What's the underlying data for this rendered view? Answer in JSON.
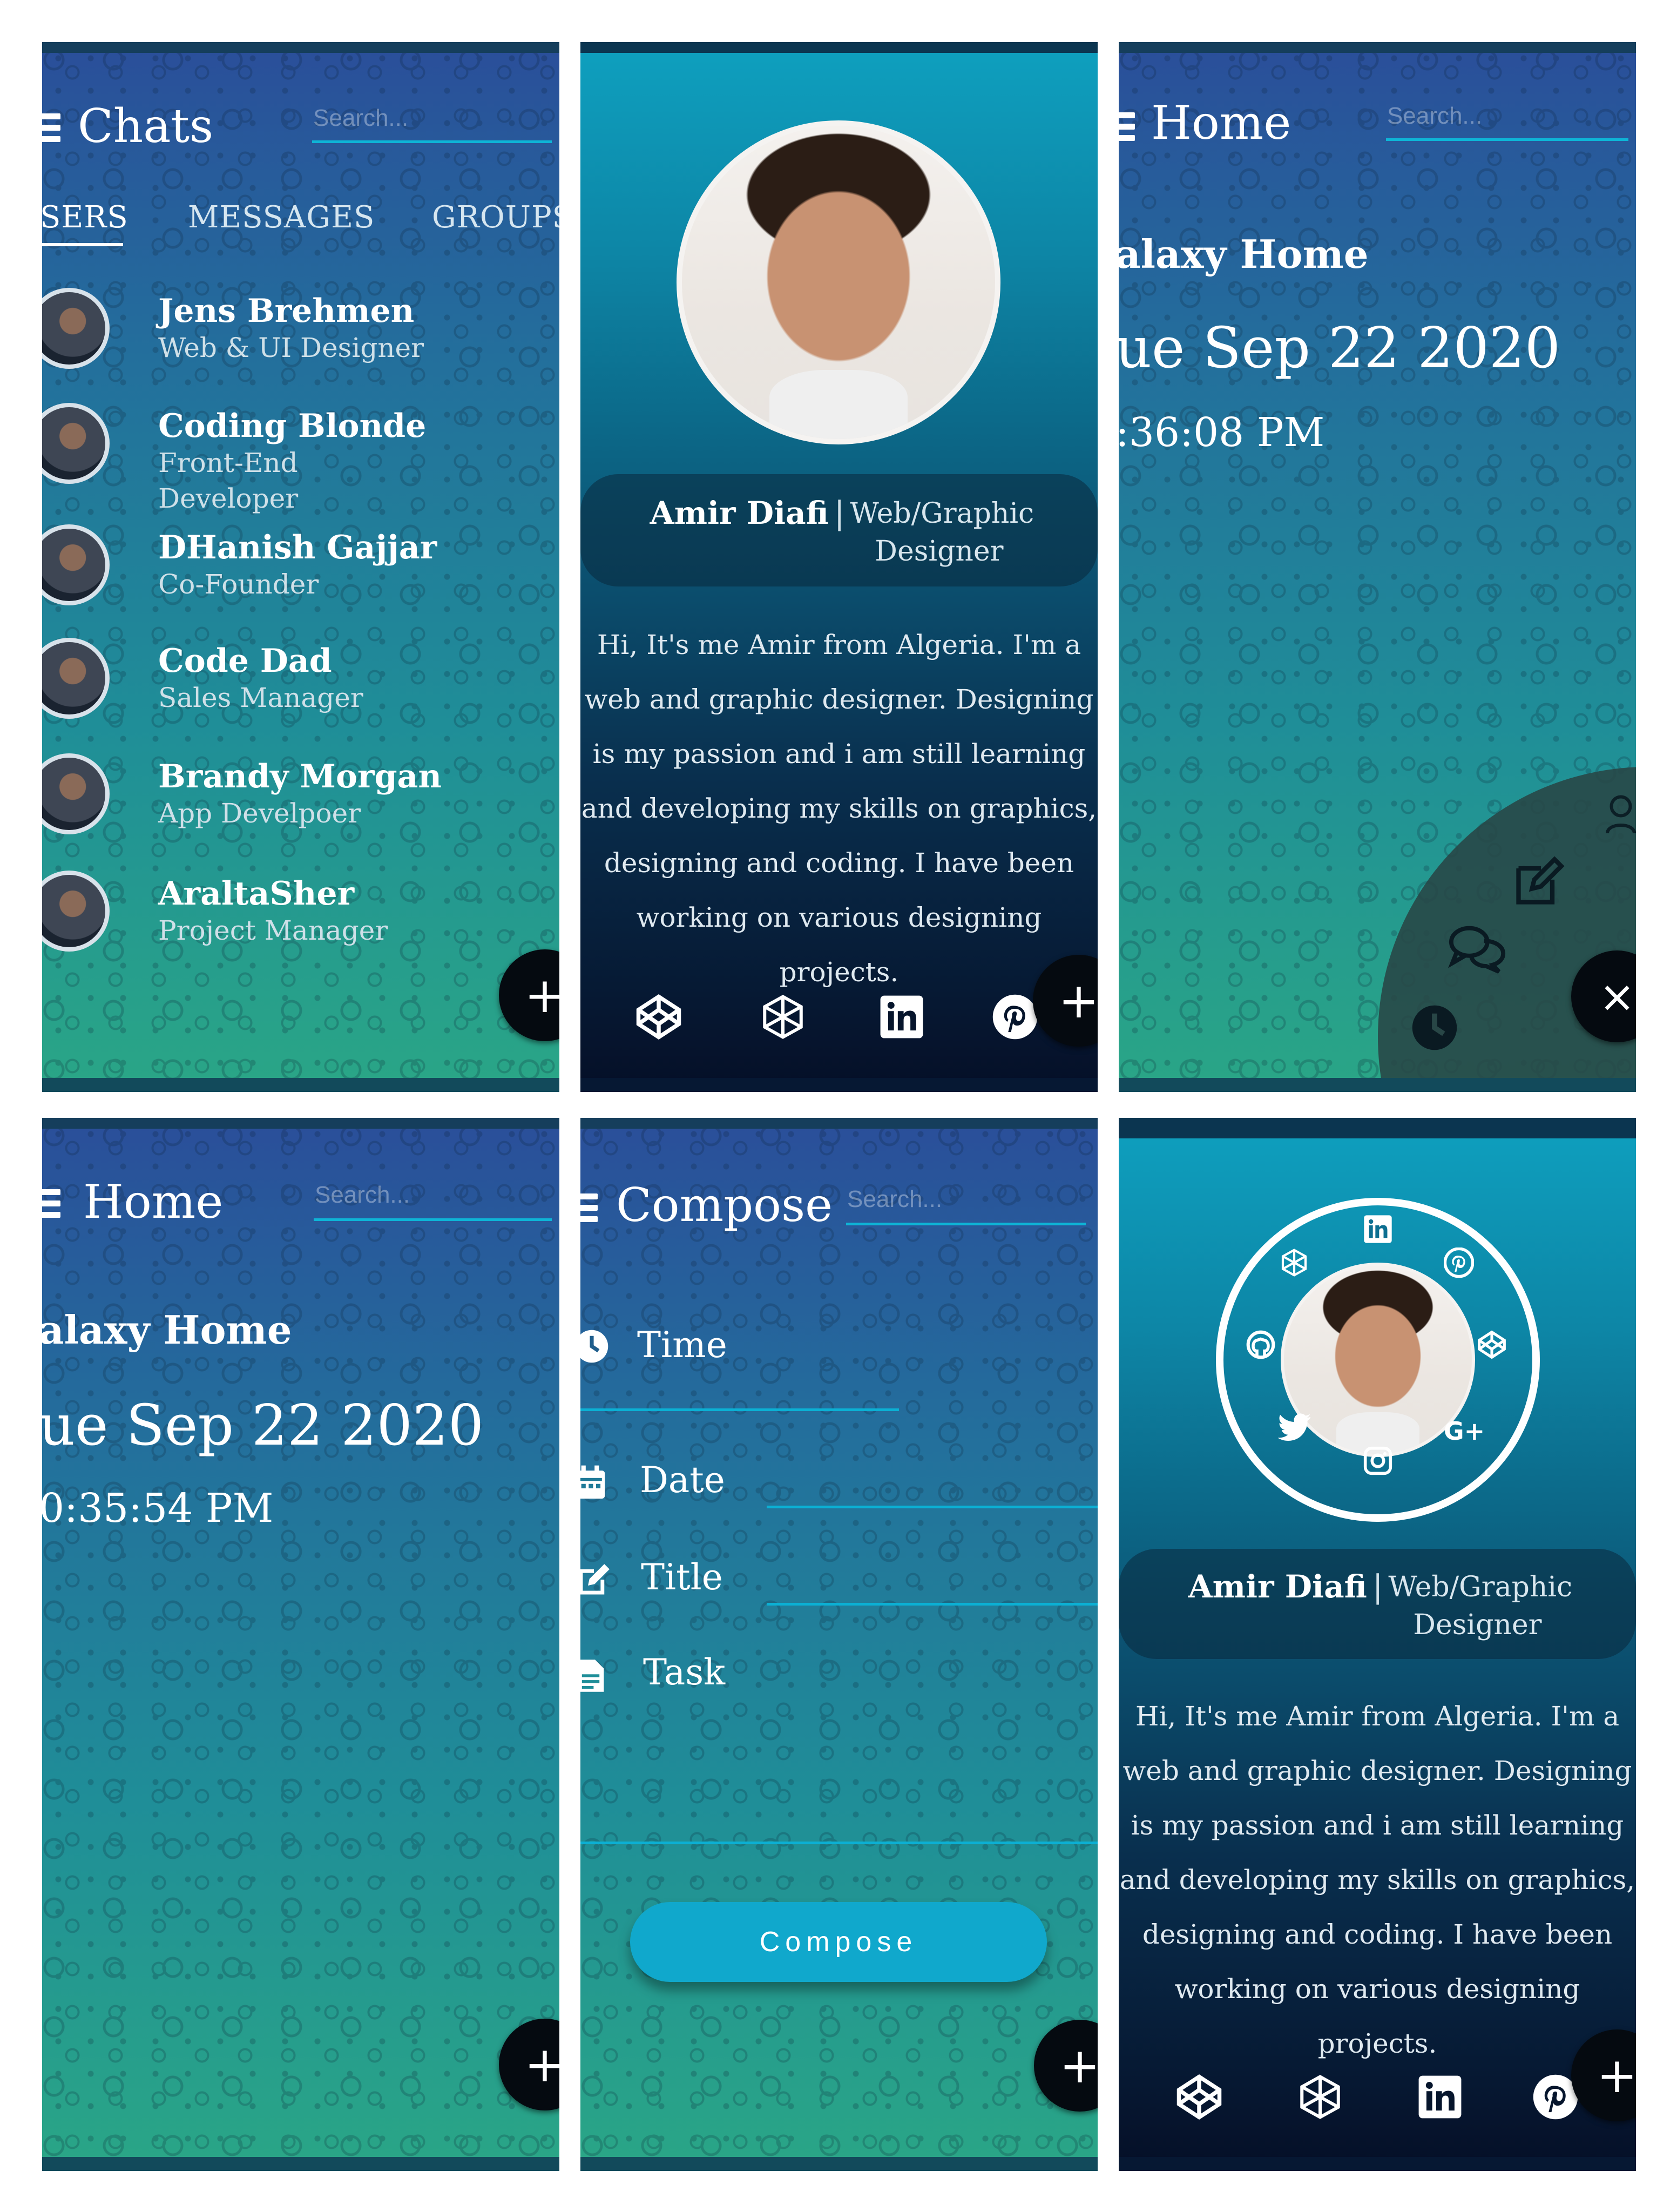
{
  "chats_screen": {
    "title": "Chats",
    "search_placeholder": "Search...",
    "tabs": [
      "SERS",
      "MESSAGES",
      "GROUPS"
    ],
    "contacts": [
      {
        "name": "Jens Brehmen",
        "role": "Web & UI Designer"
      },
      {
        "name": "Coding Blonde",
        "role": "Front-End Developer"
      },
      {
        "name": "DHanish Gajjar",
        "role": "Co-Founder"
      },
      {
        "name": "Code Dad",
        "role": "Sales Manager"
      },
      {
        "name": "Brandy Morgan",
        "role": "App Develpoer"
      },
      {
        "name": "AraltaSher",
        "role": "Project Manager"
      }
    ],
    "fab": "+"
  },
  "profile_screen": {
    "name": "Amir Diafi",
    "separator": "|",
    "role": "Web/Graphic Designer",
    "bio": "Hi, It's me Amir from Algeria. I'm a web and graphic designer. Designing is my passion and i am still learning and developing my skills on graphics, designing and coding. I have been working on various designing projects.",
    "social_icons": [
      "codepen-icon",
      "hexagon-icon",
      "linkedin-icon",
      "pinterest-icon"
    ],
    "fab": "+"
  },
  "home_menu_screen": {
    "title": "Home",
    "search_placeholder": "Search...",
    "heading": "alaxy Home",
    "date": "ue Sep 22 2020",
    "time": ":36:08 PM",
    "close": "×"
  },
  "home_screen": {
    "title": "Home",
    "search_placeholder": "Search...",
    "heading": "alaxy Home",
    "date": "ue Sep 22 2020",
    "time": "0:35:54 PM",
    "fab": "+"
  },
  "compose_screen": {
    "title": "Compose",
    "search_placeholder": "Search...",
    "fields": [
      "Time",
      "Date",
      "Title",
      "Task"
    ],
    "button": "Compose",
    "fab": "+"
  },
  "profile_ring_screen": {
    "name": "Amir Diafi",
    "separator": "|",
    "role": "Web/Graphic Designer",
    "bio": "Hi, It's me Amir from Algeria. I'm a web and graphic designer. Designing is my passion and i am still learning and developing my skills on graphics, designing and coding. I have been working on various designing projects.",
    "ring_icons": [
      "linkedin-icon",
      "pinterest-icon",
      "codepen-icon",
      "google-plus-icon",
      "instagram-icon",
      "twitter-icon",
      "github-icon",
      "hexagon-icon"
    ],
    "google_plus_label": "G+",
    "fab": "+"
  },
  "colors": {
    "accent": "#0eb4d6",
    "fab": "#050a10",
    "navy": "#050f27"
  }
}
